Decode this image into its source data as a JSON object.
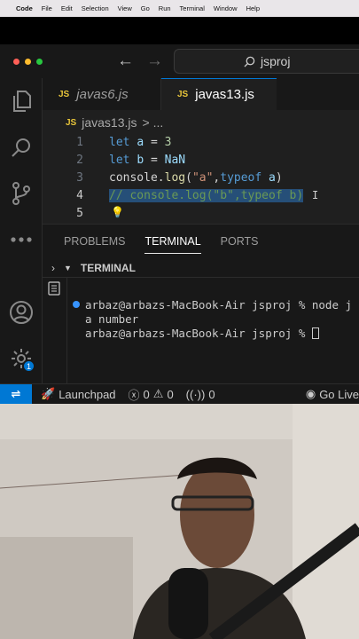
{
  "menubar": {
    "app": "Code",
    "items": [
      "File",
      "Edit",
      "Selection",
      "View",
      "Go",
      "Run",
      "Terminal",
      "Window",
      "Help"
    ]
  },
  "titlebar": {
    "search_text": "jsproj",
    "traffic_colors": [
      "#ff5f57",
      "#febc2e",
      "#28c840"
    ]
  },
  "activitybar": {
    "icons": [
      "explorer-icon",
      "search-icon",
      "source-control-icon",
      "more-icon",
      "account-icon",
      "settings-icon"
    ],
    "settings_badge": "1"
  },
  "tabs": [
    {
      "badge": "JS",
      "label": "javas6.js",
      "active": false
    },
    {
      "badge": "JS",
      "label": "javas13.js",
      "active": true
    }
  ],
  "breadcrumb": {
    "badge": "JS",
    "file": "javas13.js",
    "separator": "> ..."
  },
  "editor": {
    "line_numbers": [
      "1",
      "2",
      "3",
      "4",
      "5"
    ],
    "lines": [
      "let a = 3",
      "let b = NaN",
      "console.log(\"a\",typeof a)",
      "// console.log(\"b\",typeof b)",
      ""
    ]
  },
  "panel": {
    "tabs": [
      "PROBLEMS",
      "TERMINAL",
      "PORTS"
    ],
    "active_tab": "TERMINAL",
    "terminal_title": "TERMINAL",
    "terminal_lines": [
      "arbaz@arbazs-MacBook-Air jsproj % node j",
      "a number",
      "arbaz@arbazs-MacBook-Air jsproj % "
    ]
  },
  "statusbar": {
    "remote": "⇌",
    "launchpad": "Launchpad",
    "errors": "0",
    "warnings": "0",
    "ports": "0",
    "golive": "Go Live"
  },
  "colors": {
    "accent": "#0078d4",
    "editor_bg": "#1f1f1f",
    "selection": "#264f78"
  }
}
